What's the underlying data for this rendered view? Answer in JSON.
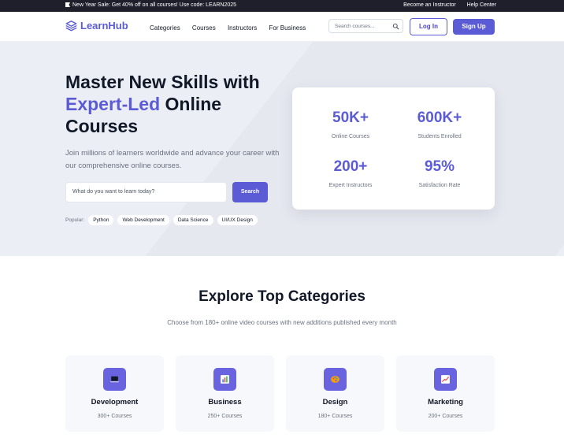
{
  "announcement": {
    "promo_text": "New Year Sale: Get 40% off on all courses! Use code: LEARN2025",
    "links": [
      "Become an Instructor",
      "Help Center"
    ]
  },
  "header": {
    "brand": "LearnHub",
    "nav": [
      "Categories",
      "Courses",
      "Instructors",
      "For Business"
    ],
    "search_placeholder": "Search courses...",
    "login_label": "Log In",
    "signup_label": "Sign Up"
  },
  "hero": {
    "title_line1": "Master New Skills with",
    "title_accent": "Expert-Led",
    "title_rest": " Online",
    "title_line3": "Courses",
    "subtitle": "Join millions of learners worldwide and advance your career with our comprehensive online courses.",
    "search_placeholder": "What do you want to learn today?",
    "search_button": "Search",
    "popular_label": "Popular:",
    "popular_tags": [
      "Python",
      "Web Development",
      "Data Science",
      "UI/UX Design"
    ]
  },
  "stats": [
    {
      "value": "50K+",
      "label": "Online Courses"
    },
    {
      "value": "600K+",
      "label": "Students Enrolled"
    },
    {
      "value": "200+",
      "label": "Expert Instructors"
    },
    {
      "value": "95%",
      "label": "Satisfaction Rate"
    }
  ],
  "categories": {
    "title": "Explore Top Categories",
    "subtitle": "Choose from 180+ online video courses with new additions published every month",
    "items": [
      {
        "name": "Development",
        "count": "300+ Courses",
        "icon": "laptop-icon"
      },
      {
        "name": "Business",
        "count": "250+ Courses",
        "icon": "bar-chart-icon"
      },
      {
        "name": "Design",
        "count": "180+ Courses",
        "icon": "palette-icon"
      },
      {
        "name": "Marketing",
        "count": "200+ Courses",
        "icon": "trend-chart-icon"
      }
    ]
  },
  "colors": {
    "accent": "#5b5bd6",
    "topbar": "#1f1f2b",
    "hero_bg": "#eceef5"
  }
}
